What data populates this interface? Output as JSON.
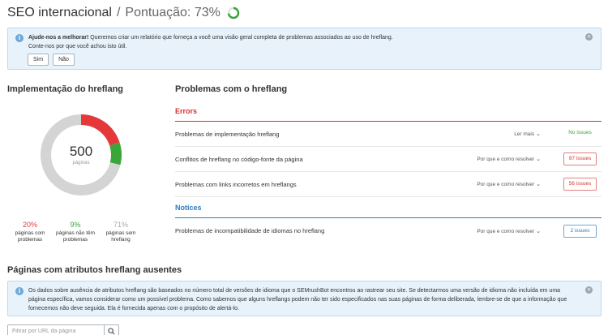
{
  "header": {
    "title": "SEO internacional",
    "separator": "/",
    "score_label": "Pontuação: 73%",
    "score_value": 73,
    "score_color": "#3ba03b"
  },
  "feedback_banner": {
    "icon": "info-icon",
    "bold_text": "Ajude-nos a melhorar!",
    "text": " Queremos criar um relatório que forneça a você uma visão geral completa de problemas associados ao uso de hreflang.",
    "text2": "Conte-nos por que você achou isto útil.",
    "yes_label": "Sim",
    "no_label": "Não",
    "close_icon": "close-icon"
  },
  "implementation": {
    "title": "Implementação do hreflang",
    "total": "500",
    "total_label": "páginas",
    "segments": [
      {
        "fraction": 0.2,
        "color": "#e5383b"
      },
      {
        "fraction": 0.09,
        "color": "#3aa63a"
      },
      {
        "fraction": 0.71,
        "color": "#d4d4d4"
      }
    ],
    "stats": [
      {
        "pct": "20%",
        "label": "páginas com problemas",
        "color": "#e5383b"
      },
      {
        "pct": "9%",
        "label": "páginas não têm problemas",
        "color": "#3aa63a"
      },
      {
        "pct": "71%",
        "label": "páginas sem hreflang",
        "color": "#aaaaaa"
      }
    ]
  },
  "problems": {
    "title": "Problemas com o hreflang",
    "errors_label": "Errors",
    "notices_label": "Notices",
    "rows": [
      {
        "label": "Problemas de implementação hreflang",
        "link": "Ler mais",
        "badge": "No issues"
      },
      {
        "label": "Conflitos de hreflang no código-fonte da página",
        "link": "Por que e como resolver",
        "badge": "97 issues"
      },
      {
        "label": "Problemas com links incorretos em hreflangs",
        "link": "Por que e como resolver",
        "badge": "56 issues"
      },
      {
        "label": "Problemas de incompatibilidade de idiomas no hreflang",
        "link": "Por que e como resolver",
        "badge": "2 issues"
      }
    ]
  },
  "missing": {
    "title": "Páginas com atributos hreflang ausentes",
    "info_text": "Os dados sobre ausência de atributos hreflang são baseados no número total de versões de idioma que o SEMrushBot encontrou ao rastrear seu site. Se detectarmos uma versão de idioma não incluída em uma página específica, vamos considerar como um possível problema. Como sabemos que alguns hreflangs podem não ter sido especificados nas suas páginas de forma deliberada, lembre-se de que a informação que fornecemos não deve seguida. Ela é fornecida apenas com o propósito de alertá-lo.",
    "search_placeholder": "Filtrar por URL da página",
    "search_icon": "search-icon"
  }
}
